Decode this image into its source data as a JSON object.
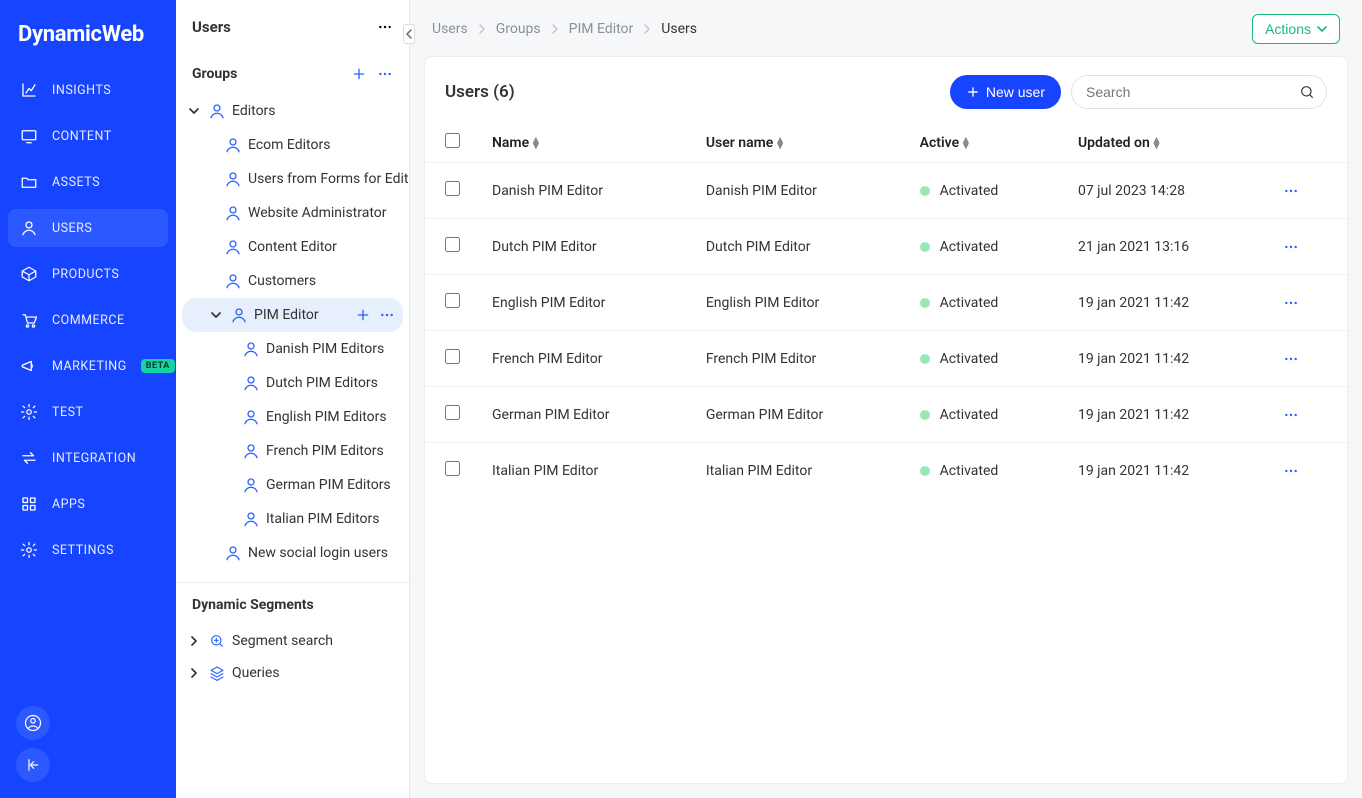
{
  "brand": "DynamicWeb",
  "nav": [
    {
      "label": "INSIGHTS",
      "icon": "chart"
    },
    {
      "label": "CONTENT",
      "icon": "monitor"
    },
    {
      "label": "ASSETS",
      "icon": "folder"
    },
    {
      "label": "USERS",
      "icon": "user",
      "active": true
    },
    {
      "label": "PRODUCTS",
      "icon": "box"
    },
    {
      "label": "COMMERCE",
      "icon": "cart"
    },
    {
      "label": "MARKETING",
      "icon": "megaphone",
      "badge": "BETA"
    },
    {
      "label": "TEST",
      "icon": "gear"
    },
    {
      "label": "INTEGRATION",
      "icon": "swap"
    },
    {
      "label": "APPS",
      "icon": "grid"
    },
    {
      "label": "SETTINGS",
      "icon": "gear"
    }
  ],
  "panel": {
    "title": "Users",
    "sections": {
      "groups": {
        "heading": "Groups",
        "items": [
          {
            "label": "Editors",
            "depth": 0,
            "icon": "user",
            "expanded": true
          },
          {
            "label": "Ecom Editors",
            "depth": 1,
            "icon": "user"
          },
          {
            "label": "Users from Forms for Editors",
            "depth": 1,
            "icon": "user"
          },
          {
            "label": "Website Administrator",
            "depth": 1,
            "icon": "user"
          },
          {
            "label": "Content Editor",
            "depth": 1,
            "icon": "user"
          },
          {
            "label": "Customers",
            "depth": 1,
            "icon": "user"
          },
          {
            "label": "PIM Editor",
            "depth": 1,
            "icon": "user",
            "selected": true,
            "expanded": true
          },
          {
            "label": "Danish PIM Editors",
            "depth": 2,
            "icon": "user"
          },
          {
            "label": "Dutch PIM Editors",
            "depth": 2,
            "icon": "user"
          },
          {
            "label": "English PIM Editors",
            "depth": 2,
            "icon": "user"
          },
          {
            "label": "French PIM Editors",
            "depth": 2,
            "icon": "user"
          },
          {
            "label": "German PIM Editors",
            "depth": 2,
            "icon": "user"
          },
          {
            "label": "Italian PIM Editors",
            "depth": 2,
            "icon": "user"
          },
          {
            "label": "New social login users",
            "depth": 1,
            "icon": "user"
          }
        ]
      },
      "segments": {
        "heading": "Dynamic Segments",
        "items": [
          {
            "label": "Segment search",
            "depth": 0,
            "icon": "search-plus",
            "collapsed": true
          },
          {
            "label": "Queries",
            "depth": 0,
            "icon": "layers",
            "collapsed": true
          }
        ]
      }
    }
  },
  "breadcrumb": [
    {
      "label": "Users"
    },
    {
      "label": "Groups"
    },
    {
      "label": "PIM Editor"
    },
    {
      "label": "Users",
      "current": true
    }
  ],
  "actions_label": "Actions",
  "card": {
    "title": "Users (6)",
    "new_user_label": "New user",
    "search_placeholder": "Search",
    "columns": [
      "Name",
      "User name",
      "Active",
      "Updated on"
    ],
    "rows": [
      {
        "name": "Danish PIM Editor",
        "username": "Danish PIM Editor",
        "status": "Activated",
        "updated": "07 jul 2023 14:28"
      },
      {
        "name": "Dutch PIM Editor",
        "username": "Dutch PIM Editor",
        "status": "Activated",
        "updated": "21 jan 2021 13:16"
      },
      {
        "name": "English PIM Editor",
        "username": "English PIM Editor",
        "status": "Activated",
        "updated": "19 jan 2021 11:42"
      },
      {
        "name": "French PIM Editor",
        "username": "French PIM Editor",
        "status": "Activated",
        "updated": "19 jan 2021 11:42"
      },
      {
        "name": "German PIM Editor",
        "username": "German PIM Editor",
        "status": "Activated",
        "updated": "19 jan 2021 11:42"
      },
      {
        "name": "Italian PIM Editor",
        "username": "Italian PIM Editor",
        "status": "Activated",
        "updated": "19 jan 2021 11:42"
      }
    ]
  }
}
